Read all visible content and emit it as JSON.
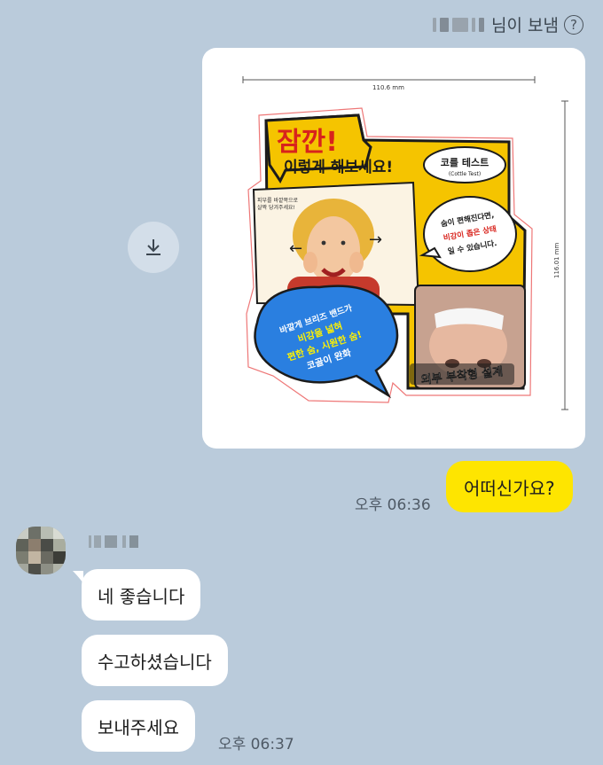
{
  "header": {
    "sender_suffix": "님이 보냄",
    "help_glyph": "?"
  },
  "image_message": {
    "dim_width": "110.6 mm",
    "dim_height": "116.01 mm",
    "sticker": {
      "headline": "잠깐!",
      "subhead": "이렇게 해보세요!",
      "badge_title": "코를 테스트",
      "badge_sub": "(Cottle Test)",
      "photo_note_line1": "피부를 바깥쪽으로",
      "photo_note_line2": "살짝 당겨주세요!",
      "bubble_right_line1": "숨이 편해진다면,",
      "bubble_right_line2": "비강이 좁은 상태",
      "bubble_right_line3": "일 수 있습니다.",
      "bubble_left_line1": "바깥게 브리즈 밴드가",
      "bubble_left_line2": "비강을 넓혀",
      "bubble_left_line3": "편한 숨, 시원한 숨!",
      "bubble_left_line4": "코골이 완화",
      "product_caption": "외부 부착형 설계"
    }
  },
  "messages": [
    {
      "side": "me",
      "text": "어떠신가요?",
      "time": "오후 06:36"
    },
    {
      "side": "other",
      "text": "네 좋습니다"
    },
    {
      "side": "other",
      "text": "수고하셨습니다"
    },
    {
      "side": "other",
      "text": "보내주세요",
      "time": "오후 06:37"
    }
  ],
  "colors": {
    "background": "#bacbdb",
    "my_bubble": "#fee500",
    "other_bubble": "#ffffff",
    "sticker_yellow": "#f5c400",
    "sticker_blue": "#2a7fe0",
    "sticker_red": "#d8231c"
  },
  "icons": {
    "download": "download-icon",
    "help": "help-icon"
  }
}
